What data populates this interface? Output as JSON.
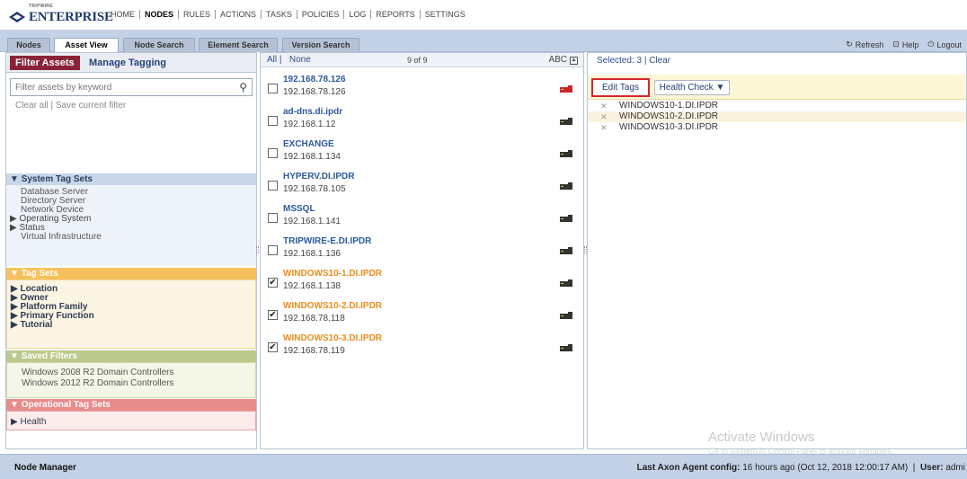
{
  "app": {
    "logo_text": "ENTERPRISE",
    "logo_sup": "TRIPWIRE"
  },
  "main_nav": [
    "HOME",
    "NODES",
    "RULES",
    "ACTIONS",
    "TASKS",
    "POLICIES",
    "LOG",
    "REPORTS",
    "SETTINGS"
  ],
  "main_nav_active": "NODES",
  "tabs": [
    "Nodes",
    "Asset View",
    "Node Search",
    "Element Search",
    "Version Search"
  ],
  "active_tab": "Asset View",
  "toolbar": {
    "refresh": "Refresh",
    "help": "Help",
    "logout": "Logout"
  },
  "left": {
    "filter_tab": "Filter Assets",
    "manage_tab": "Manage Tagging",
    "search_placeholder": "Filter assets by keyword",
    "clear_all": "Clear all",
    "save_filter": "Save current filter",
    "system_tag_sets": {
      "title": "System Tag Sets",
      "items": [
        {
          "label": "Database Server",
          "expander": false
        },
        {
          "label": "Directory Server",
          "expander": false
        },
        {
          "label": "Network Device",
          "expander": false
        },
        {
          "label": "Operating System",
          "expander": true
        },
        {
          "label": "Status",
          "expander": true
        },
        {
          "label": "Virtual Infrastructure",
          "expander": false
        }
      ]
    },
    "tag_sets": {
      "title": "Tag Sets",
      "items": [
        "Location",
        "Owner",
        "Platform Family",
        "Primary Function",
        "Tutorial"
      ]
    },
    "saved_filters": {
      "title": "Saved Filters",
      "items": [
        "Windows 2008 R2 Domain Controllers",
        "Windows 2012 R2 Domain Controllers"
      ]
    },
    "operational_tag_sets": {
      "title": "Operational Tag Sets",
      "items": [
        "Health"
      ]
    }
  },
  "middle": {
    "all": "All",
    "none": "None",
    "count": "9 of 9",
    "sort": "ABC",
    "nodes": [
      {
        "name": "192.168.78.126",
        "ip": "192.168.78.126",
        "checked": false,
        "device_color": "#c9262c"
      },
      {
        "name": "ad-dns.di.ipdr",
        "ip": "192.168.1.12",
        "checked": false,
        "device_color": "#333333"
      },
      {
        "name": "EXCHANGE",
        "ip": "192.168.1.134",
        "checked": false,
        "device_color": "#333333"
      },
      {
        "name": "HYPERV.DI.IPDR",
        "ip": "192.168.78.105",
        "checked": false,
        "device_color": "#333333"
      },
      {
        "name": "MSSQL",
        "ip": "192.168.1.141",
        "checked": false,
        "device_color": "#333333"
      },
      {
        "name": "TRIPWIRE-E.DI.IPDR",
        "ip": "192.168.1.136",
        "checked": false,
        "device_color": "#333333"
      },
      {
        "name": "WINDOWS10-1.DI.IPDR",
        "ip": "192.168.1.138",
        "checked": true,
        "device_color": "#333333"
      },
      {
        "name": "WINDOWS10-2.DI.IPDR",
        "ip": "192.168.78.118",
        "checked": true,
        "device_color": "#333333"
      },
      {
        "name": "WINDOWS10-3.DI.IPDR",
        "ip": "192.168.78.119",
        "checked": true,
        "device_color": "#333333"
      }
    ]
  },
  "right": {
    "selected": "Selected: 3",
    "clear": "Clear",
    "edit_tags": "Edit Tags",
    "health_check": "Health Check ▼",
    "selected_items": [
      "WINDOWS10-1.DI.IPDR",
      "WINDOWS10-2.DI.IPDR",
      "WINDOWS10-3.DI.IPDR"
    ]
  },
  "watermark": {
    "line1": "Activate Windows",
    "line2": "Go to System in Control Panel to activate Windows."
  },
  "footer": {
    "left": "Node Manager",
    "agent_label": "Last Axon Agent config:",
    "agent_value": "16 hours ago (Oct 12, 2018 12:00:17 AM)",
    "user_label": "User:",
    "user_value": "admi"
  },
  "colors": {
    "accent": "#8a2338",
    "link": "#2b5a9c",
    "selected_node": "#f08c1c",
    "edit_tags_border": "#d6262c"
  }
}
